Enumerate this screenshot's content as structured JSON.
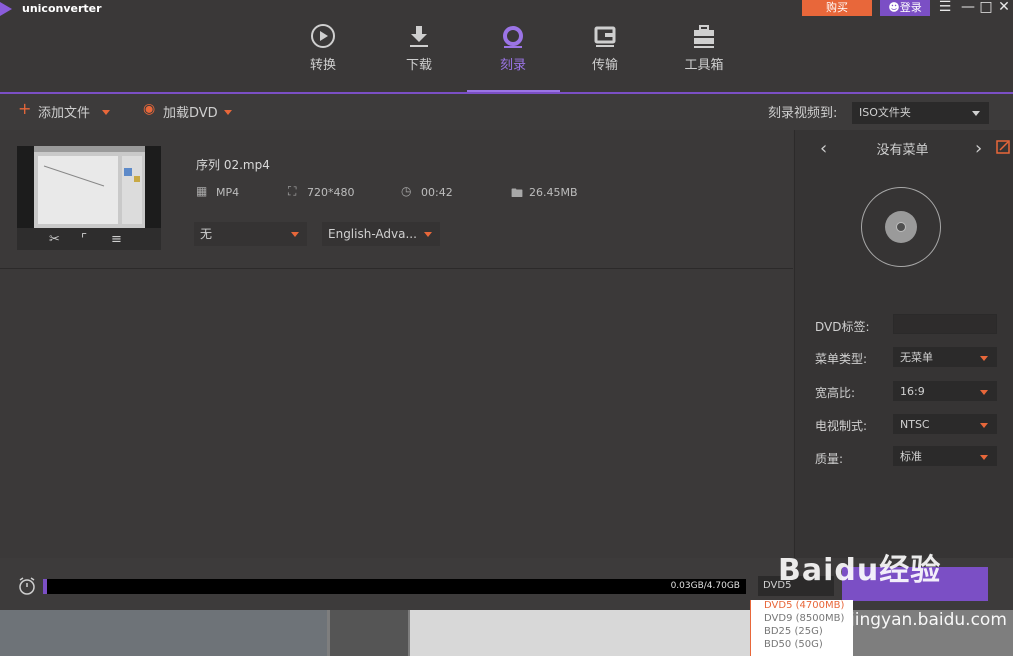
{
  "app": {
    "title": "uniconverter"
  },
  "window": {
    "buy_label": "购买",
    "login_label": "登录"
  },
  "nav": {
    "items": [
      {
        "label": "转换",
        "icon": "convert-icon"
      },
      {
        "label": "下载",
        "icon": "download-icon"
      },
      {
        "label": "刻录",
        "icon": "burn-disc-icon",
        "active": true
      },
      {
        "label": "传输",
        "icon": "transfer-icon"
      },
      {
        "label": "工具箱",
        "icon": "toolbox-icon"
      }
    ]
  },
  "toolbar": {
    "add_file": "添加文件",
    "load_dvd": "加载DVD",
    "burn_to_label": "刻录视频到:",
    "burn_to_value": "ISO文件夹"
  },
  "file": {
    "name": "序列 02.mp4",
    "format": "MP4",
    "resolution": "720*480",
    "duration": "00:42",
    "size": "26.45MB",
    "subtitle_select": "无",
    "audio_select": "English-Adva..."
  },
  "menu_panel": {
    "title": "没有菜单",
    "dvd_label": "DVD标签:",
    "dvd_label_value": "",
    "menu_type_label": "菜单类型:",
    "menu_type_value": "无菜单",
    "aspect_label": "宽高比:",
    "aspect_value": "16:9",
    "tv_std_label": "电视制式:",
    "tv_std_value": "NTSC",
    "quality_label": "质量:",
    "quality_value": "标准"
  },
  "bottom": {
    "progress_fraction": 0.0064,
    "progress_text": "0.03GB/4.70GB",
    "disc_select": "DVD5 (4700MB)",
    "disc_options": [
      "DVD5 (4700MB)",
      "DVD9 (8500MB)",
      "BD25 (25G)",
      "BD50 (50G)"
    ]
  },
  "watermark": {
    "brand": "Baidu经验",
    "url": "jingyan.baidu.com"
  },
  "colors": {
    "accent": "#7b4fc5",
    "orange": "#e8673a"
  }
}
